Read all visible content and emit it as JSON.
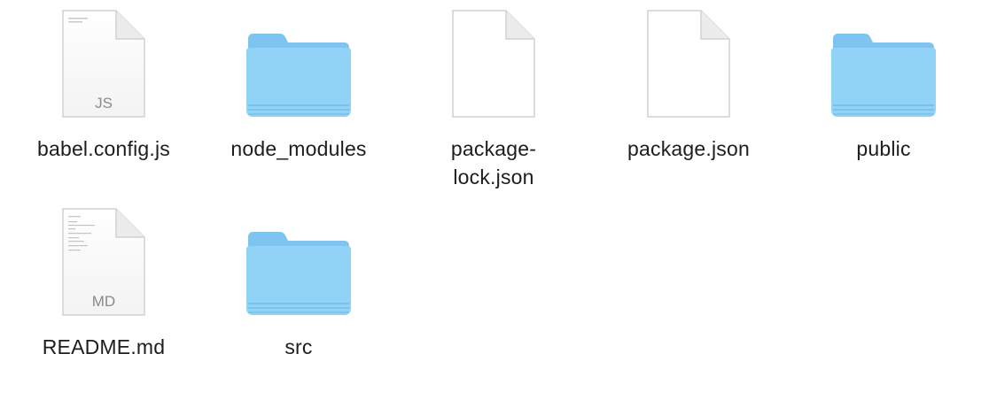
{
  "window": {
    "view": "icon-grid"
  },
  "items": [
    {
      "kind": "file",
      "name": "babel.config.js",
      "badge": "JS",
      "preview": "code"
    },
    {
      "kind": "folder",
      "name": "node_modules"
    },
    {
      "kind": "file",
      "name": "package-lock.json",
      "badge": "",
      "preview": "blank",
      "name_lines": [
        "package-",
        "lock.json"
      ]
    },
    {
      "kind": "file",
      "name": "package.json",
      "badge": "",
      "preview": "blank"
    },
    {
      "kind": "folder",
      "name": "public"
    },
    {
      "kind": "file",
      "name": "README.md",
      "badge": "MD",
      "preview": "text"
    },
    {
      "kind": "folder",
      "name": "src"
    }
  ],
  "colors": {
    "folder_back": "#7fc4f0",
    "folder_front": "#91d2f7",
    "folder_stripe": "#6cb7e8",
    "label": "#1d1d1f",
    "badge": "#8a8a8e"
  }
}
